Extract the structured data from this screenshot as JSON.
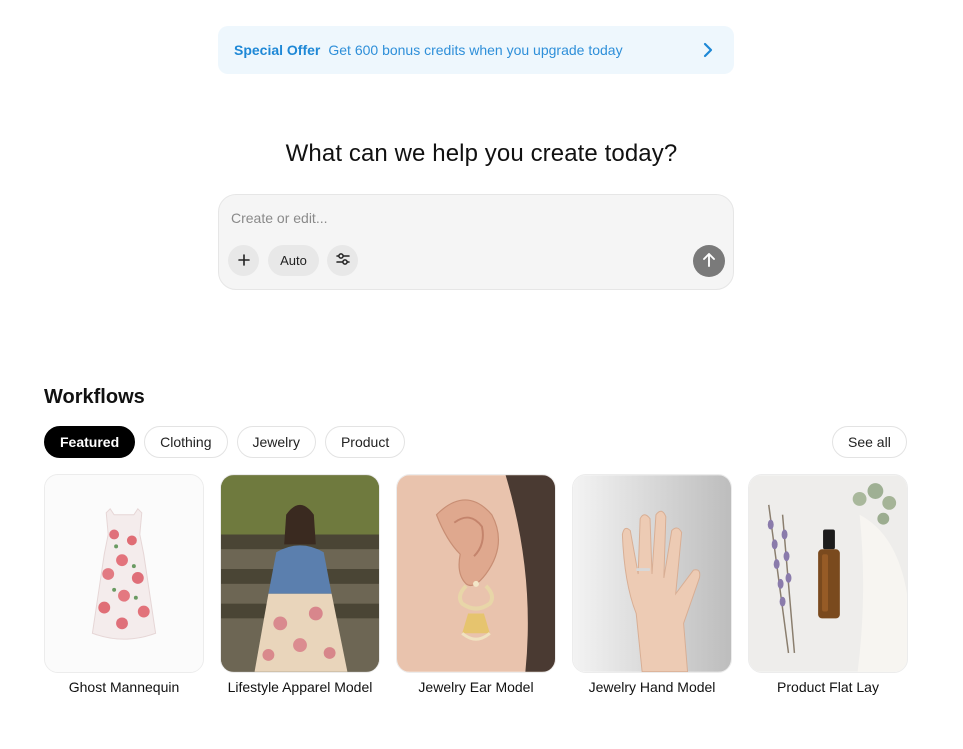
{
  "offer": {
    "title": "Special Offer",
    "text": "Get 600 bonus credits when you upgrade today",
    "icon": "chevron-right-icon"
  },
  "headline": "What can we help you create today?",
  "prompt": {
    "placeholder": "Create or edit...",
    "value": "",
    "add_icon": "plus-icon",
    "auto_label": "Auto",
    "settings_icon": "sliders-icon",
    "send_icon": "arrow-up-icon"
  },
  "workflows": {
    "title": "Workflows",
    "tabs": [
      {
        "label": "Featured",
        "active": true
      },
      {
        "label": "Clothing",
        "active": false
      },
      {
        "label": "Jewelry",
        "active": false
      },
      {
        "label": "Product",
        "active": false
      }
    ],
    "see_all": "See all",
    "cards": [
      {
        "label": "Ghost Mannequin"
      },
      {
        "label": "Lifestyle Apparel Model"
      },
      {
        "label": "Jewelry Ear Model"
      },
      {
        "label": "Jewelry Hand Model"
      },
      {
        "label": "Product Flat Lay"
      }
    ]
  },
  "colors": {
    "accent": "#1e88d6",
    "banner_bg": "#eef7fd",
    "active_tab": "#000000",
    "send_button": "#7a7a7a"
  }
}
